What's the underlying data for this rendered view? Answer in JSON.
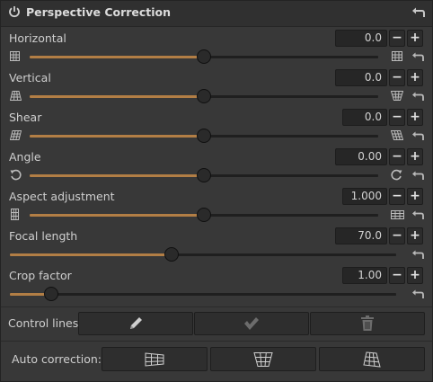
{
  "header": {
    "title": "Perspective Correction"
  },
  "sliders": [
    {
      "label": "Horizontal",
      "value": "0.0",
      "position": 0.5
    },
    {
      "label": "Vertical",
      "value": "0.0",
      "position": 0.5
    },
    {
      "label": "Shear",
      "value": "0.0",
      "position": 0.5
    },
    {
      "label": "Angle",
      "value": "0.00",
      "position": 0.5
    },
    {
      "label": "Aspect adjustment",
      "value": "1.000",
      "position": 0.5
    },
    {
      "label": "Focal length",
      "value": "70.0",
      "position": 0.41
    },
    {
      "label": "Crop factor",
      "value": "1.00",
      "position": 0.1
    }
  ],
  "control_lines": {
    "label": "Control lines:"
  },
  "auto_correction": {
    "label": "Auto correction:"
  },
  "icons": {
    "minus": "−",
    "plus": "+",
    "accent": "#b27e45"
  }
}
